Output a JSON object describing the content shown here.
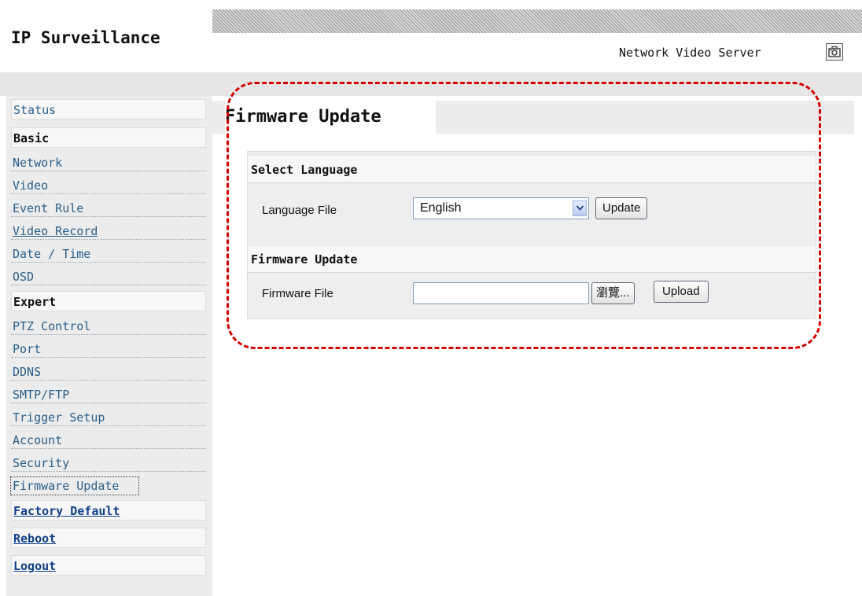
{
  "header": {
    "app_title": "IP Surveillance",
    "device_title": "Network Video Server",
    "device_icon": "camera-snapshot-icon"
  },
  "sidebar": {
    "status": "Status",
    "basic": {
      "title": "Basic",
      "items": [
        "Network",
        "Video",
        "Event Rule",
        "Video Record",
        "Date / Time",
        "OSD"
      ]
    },
    "expert": {
      "title": "Expert",
      "items": [
        "PTZ Control",
        "Port",
        "DDNS",
        "SMTP/FTP",
        "Trigger Setup",
        "Account",
        "Security",
        "Firmware Update"
      ]
    },
    "factory_default": "Factory Default",
    "reboot": "Reboot",
    "logout": "Logout"
  },
  "main": {
    "page_title": "Firmware Update",
    "language_section": {
      "title": "Select Language",
      "label": "Language File",
      "selected": "English",
      "button": "Update"
    },
    "firmware_section": {
      "title": "Firmware Update",
      "label": "Firmware File",
      "value": "",
      "browse_button": "瀏覽...",
      "upload_button": "Upload"
    }
  },
  "colors": {
    "highlight_dash": "#d40000",
    "nav_link": "#2a5f8c",
    "strong_link": "#103f8c"
  }
}
